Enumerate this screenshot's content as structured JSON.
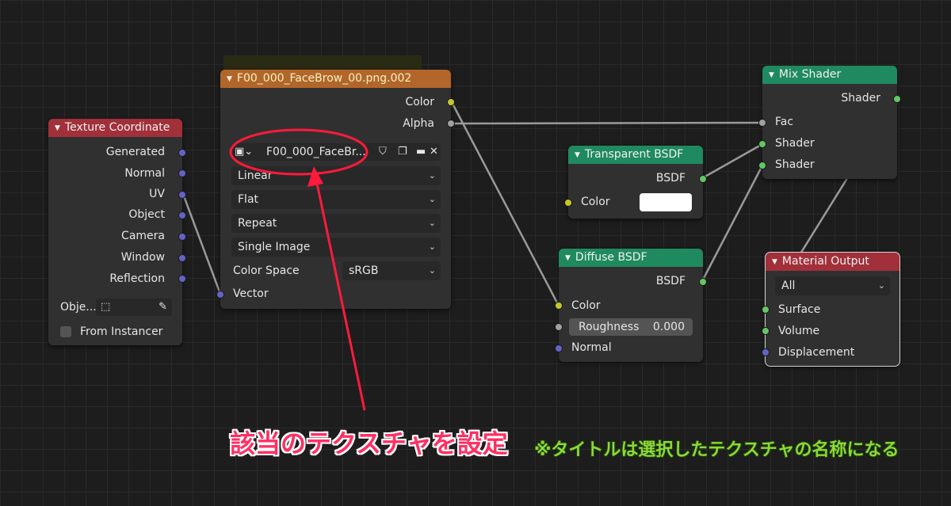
{
  "texture_coordinate": {
    "title": "Texture Coordinate",
    "outputs": [
      "Generated",
      "Normal",
      "UV",
      "Object",
      "Camera",
      "Window",
      "Reflection"
    ],
    "object_label": "Obje...",
    "from_instancer": "From Instancer",
    "header_color": "#a1303a"
  },
  "image_texture": {
    "title": "F00_000_FaceBrow_00.png.002",
    "outputs": [
      "Color",
      "Alpha"
    ],
    "image_name": "F00_000_FaceBr...",
    "interpolation": "Linear",
    "projection": "Flat",
    "extension": "Repeat",
    "source": "Single Image",
    "color_space_label": "Color Space",
    "color_space_value": "sRGB",
    "vector_input": "Vector",
    "header_color": "#b3662a"
  },
  "transparent_bsdf": {
    "title": "Transparent BSDF",
    "output": "BSDF",
    "color_label": "Color",
    "header_color": "#1f8a5f"
  },
  "diffuse_bsdf": {
    "title": "Diffuse BSDF",
    "output": "BSDF",
    "color_label": "Color",
    "roughness_label": "Roughness",
    "roughness_value": "0.000",
    "normal_label": "Normal",
    "header_color": "#1f8a5f"
  },
  "mix_shader": {
    "title": "Mix Shader",
    "output": "Shader",
    "inputs": [
      "Fac",
      "Shader",
      "Shader"
    ],
    "header_color": "#1f8a5f"
  },
  "material_output": {
    "title": "Material Output",
    "target": "All",
    "inputs": [
      "Surface",
      "Volume",
      "Displacement"
    ],
    "header_color": "#a1303a"
  },
  "annotations": {
    "main": "該当のテクスチャを設定",
    "note": "※タイトルは選択したテクスチャの名称になる",
    "accent_red": "#ff1a3c",
    "accent_green": "#8cd83a"
  }
}
